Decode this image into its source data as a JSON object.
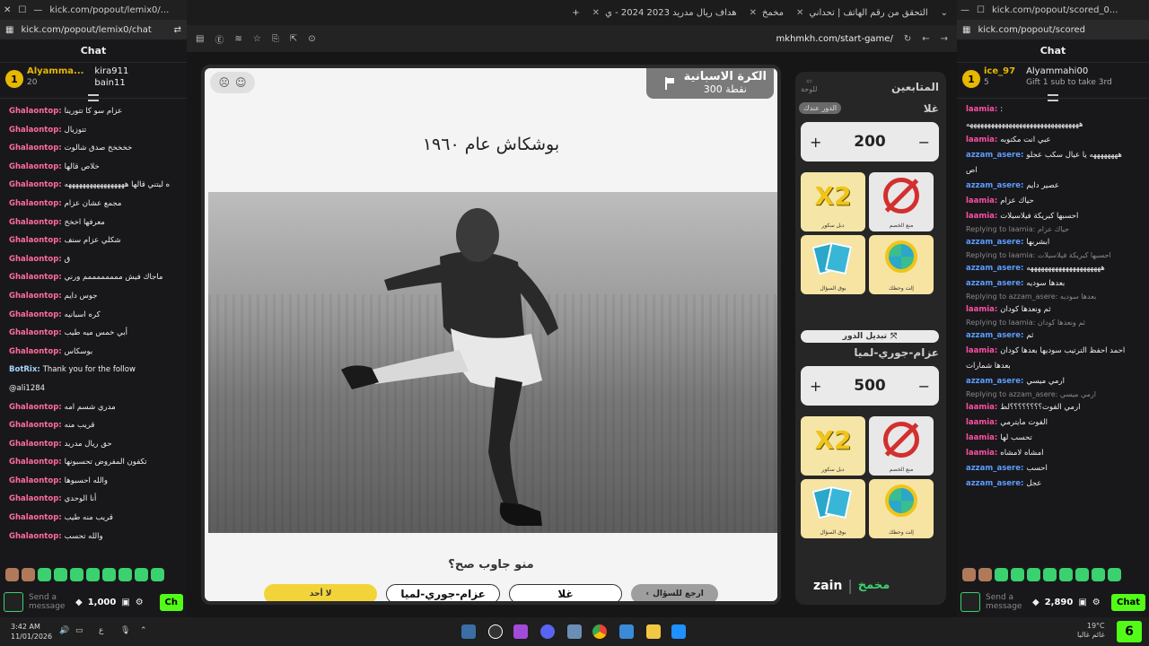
{
  "left_chat": {
    "url": "kick.com/popout/lemix0/...",
    "address": "kick.com/popout/lemix0/chat",
    "title": "Chat",
    "leaderboard": {
      "rank": "1",
      "name": "Alyamma...",
      "points": "20",
      "second": "kira911",
      "third": "bain11"
    },
    "messages": [
      {
        "user": "Ghalaontop",
        "text": "عزام سو كا تتورينا"
      },
      {
        "user": "Ghalaontop",
        "text": "تتوزيال"
      },
      {
        "user": "Ghalaontop",
        "text": "خخخخخ صدق شالوت"
      },
      {
        "user": "Ghalaontop",
        "text": "خلاص قالها"
      },
      {
        "user": "Ghalaontop",
        "text": "ه ليتني قالها هههههههههههههههههه"
      },
      {
        "user": "Ghalaontop",
        "text": "مجمع عشان عزام"
      },
      {
        "user": "Ghalaontop",
        "text": "معرفها اخخخ"
      },
      {
        "user": "Ghalaontop",
        "text": "شكلي عزام سنف"
      },
      {
        "user": "Ghalaontop",
        "text": "ق"
      },
      {
        "user": "Ghalaontop",
        "text": "ماجاك فيش ممممممممم ورني"
      },
      {
        "user": "Ghalaontop",
        "text": "جوس دايم"
      },
      {
        "user": "Ghalaontop",
        "text": "كره اسبانيه"
      },
      {
        "user": "Ghalaontop",
        "text": "أبي خمس ميه طيب"
      },
      {
        "user": "Ghalaontop",
        "text": "بوسكاس"
      },
      {
        "user": "BotRix",
        "text": "Thank you for the follow",
        "bot": true
      },
      {
        "user": "",
        "text": "@ali1284"
      },
      {
        "user": "Ghalaontop",
        "text": "مدري شسم امه"
      },
      {
        "user": "Ghalaontop",
        "text": "قريب منه"
      },
      {
        "user": "Ghalaontop",
        "text": "حق ريال مدريد"
      },
      {
        "user": "Ghalaontop",
        "text": "تكفون المفروض تحسبونها"
      },
      {
        "user": "Ghalaontop",
        "text": "والله احسبوها"
      },
      {
        "user": "Ghalaontop",
        "text": "أنا الوحدي"
      },
      {
        "user": "Ghalaontop",
        "text": "قريب منه طيب"
      },
      {
        "user": "Ghalaontop",
        "text": "والله تحسب"
      }
    ],
    "send_placeholder": "Send a message",
    "points": "1,000",
    "chat_button": "Ch"
  },
  "right_chat": {
    "url": "kick.com/popout/scored_0...",
    "address": "kick.com/popout/scored",
    "title": "Chat",
    "leaderboard": {
      "rank": "1",
      "name": "ice_97",
      "points": "5",
      "second": "Alyammahi00",
      "gift_text": "Gift 1 sub to take 3rd"
    },
    "messages": [
      {
        "user": "laamia",
        "text": ":",
        "kind": "pink"
      },
      {
        "user": "",
        "text": "ههههههههههههههههههههههههههههههههه"
      },
      {
        "user": "laamia",
        "text": "عبي انت مكتوبه",
        "kind": "pink"
      },
      {
        "user": "azzam_asere",
        "text": "ههههههههه يا عيال سكب عجلو",
        "kind": "blue"
      },
      {
        "user": "",
        "text": "اص"
      },
      {
        "user": "azzam_asere",
        "text": "عصير دايم",
        "kind": "blue"
      },
      {
        "user": "laamia",
        "text": "حياك عزام",
        "kind": "pink"
      },
      {
        "user": "laamia",
        "text": "احسبها كبريكة فيلاسيلات",
        "kind": "pink"
      },
      {
        "reply": "Replying to laamia: حياك عزام"
      },
      {
        "user": "azzam_asere",
        "text": "ابشربها",
        "kind": "blue"
      },
      {
        "reply": "Replying to laamia: احسبها كبريكة فيلاسيلات"
      },
      {
        "user": "azzam_asere",
        "text": "هههههههههههههههههههههه",
        "kind": "blue"
      },
      {
        "user": "azzam_asere",
        "text": "بعدها سوديه",
        "kind": "blue"
      },
      {
        "reply": "Replying to azzam_asere: بعدها سوديه"
      },
      {
        "user": "laamia",
        "text": "ثم ونعدها كودان",
        "kind": "pink"
      },
      {
        "reply": "Replying to laamia: ثم ونعدها كودان"
      },
      {
        "user": "azzam_asere",
        "text": "ثم",
        "kind": "blue"
      },
      {
        "user": "laamia",
        "text": "احمد احفظ الترتيب سوديها بعدها كودان",
        "kind": "pink"
      },
      {
        "user": "",
        "text": "بعدها شمارات"
      },
      {
        "user": "azzam_asere",
        "text": "ارمي ميسي",
        "kind": "blue"
      },
      {
        "reply": "Replying to azzam_asere: ارمي ميسي"
      },
      {
        "user": "laamia",
        "text": "ارمي الفوت؟؟؟؟؟؟؟؟لط",
        "kind": "pink"
      },
      {
        "user": "laamia",
        "text": "الفوت مايترمي",
        "kind": "pink"
      },
      {
        "user": "laamia",
        "text": "تحسب لها",
        "kind": "pink"
      },
      {
        "user": "laamia",
        "text": "امشاه لامشاه",
        "kind": "pink"
      },
      {
        "user": "azzam_asere",
        "text": "احسب",
        "kind": "blue"
      },
      {
        "user": "azzam_asere",
        "text": "عجل",
        "kind": "blue"
      }
    ],
    "send_placeholder": "Send a message",
    "points": "2,890",
    "chat_button": "Chat"
  },
  "browser": {
    "tabs": [
      {
        "label": "التحقق من رقم الهاتف | تحداني"
      },
      {
        "label": "مخمخ"
      },
      {
        "label": "هداف ريال مدريد 2023 2024 - ي"
      }
    ],
    "url": "mkhmkh.com/start-game/"
  },
  "game": {
    "category_title": "الكرة الاسبانية",
    "category_points": "300 نقطة",
    "question": "بوشكاش عام ١٩٦٠",
    "who_label": "منو جاوب صح؟",
    "answers": {
      "back": "ارجع للسؤال",
      "team1": "غلا",
      "team2": "عزام-جوري-لميا",
      "none": "لا أحد"
    }
  },
  "panel": {
    "title": "المتابعين",
    "back_to_board": "للوحة",
    "turn_tag": "الدور عندك",
    "team1": {
      "name": "غلا",
      "score": "200"
    },
    "team2": {
      "name": "عزام-جوري-لميا",
      "score": "500"
    },
    "swap_label": "تبديل الدور",
    "powerups": {
      "double": "دبل سكور",
      "block": "منع الخصم",
      "swap_q": "بوق السؤال",
      "wheel": "إلت وحظك"
    },
    "brand": "zain"
  },
  "taskbar": {
    "time": "3:42 AM",
    "date": "11/01/2026",
    "weather": "19°C",
    "weather_text": "غائم غالبا"
  }
}
